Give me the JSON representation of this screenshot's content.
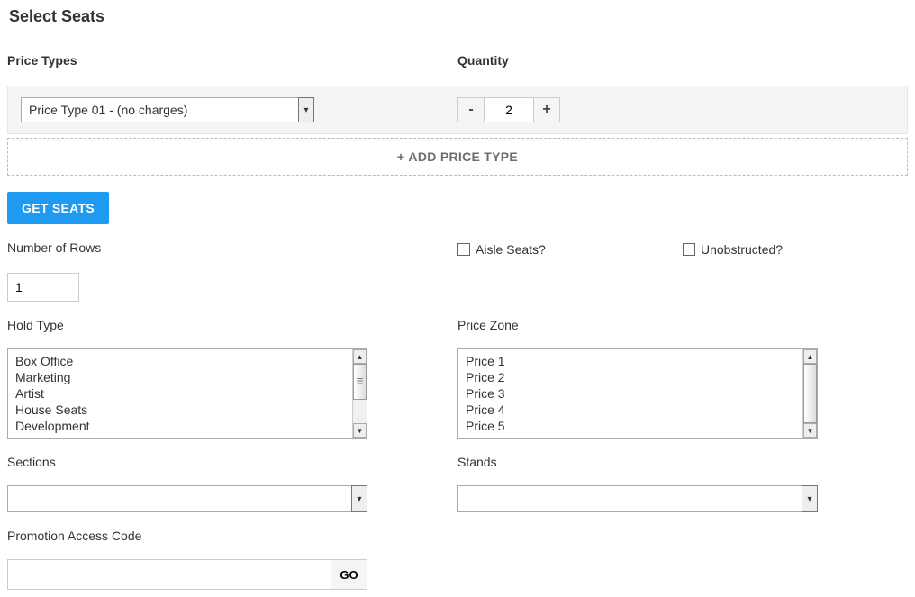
{
  "title": "Select Seats",
  "priceTypes": {
    "label": "Price Types",
    "selected": "Price Type 01 - (no charges)"
  },
  "quantity": {
    "label": "Quantity",
    "value": "2",
    "minus": "-",
    "plus": "+"
  },
  "addPriceType": {
    "plus": "+",
    "label": "ADD PRICE TYPE"
  },
  "getSeats": "GET SEATS",
  "numberOfRows": {
    "label": "Number of Rows",
    "value": "1"
  },
  "aisleSeats": {
    "label": "Aisle Seats?"
  },
  "unobstructed": {
    "label": "Unobstructed?"
  },
  "holdType": {
    "label": "Hold Type",
    "items": [
      "Box Office",
      "Marketing",
      "Artist",
      "House Seats",
      "Development"
    ]
  },
  "priceZone": {
    "label": "Price Zone",
    "items": [
      "Price 1",
      "Price 2",
      "Price 3",
      "Price 4",
      "Price 5"
    ]
  },
  "sections": {
    "label": "Sections"
  },
  "stands": {
    "label": "Stands"
  },
  "promo": {
    "label": "Promotion Access Code",
    "go": "GO"
  }
}
